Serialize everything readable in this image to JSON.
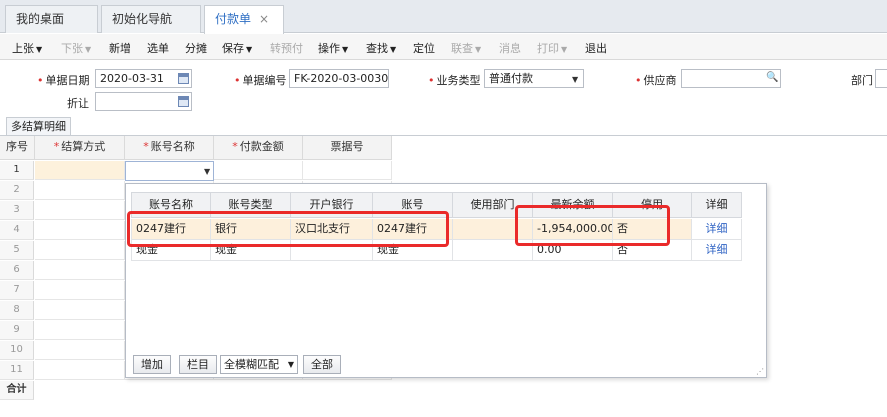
{
  "tabs": [
    {
      "label": "我的桌面"
    },
    {
      "label": "初始化导航"
    },
    {
      "label": "付款单",
      "close": "×"
    }
  ],
  "toolbar": {
    "items": [
      {
        "label": "上张",
        "caret": "▼",
        "disabled": false
      },
      {
        "label": "下张",
        "caret": "▼",
        "disabled": true
      },
      {
        "label": "新增"
      },
      {
        "label": "选单"
      },
      {
        "label": "分摊"
      },
      {
        "label": "保存",
        "caret": "▼"
      },
      {
        "label": "转预付",
        "disabled": true
      },
      {
        "label": "操作",
        "caret": "▼"
      },
      {
        "label": "查找",
        "caret": "▼"
      },
      {
        "label": "定位"
      },
      {
        "label": "联查",
        "caret": "▼",
        "disabled": true
      },
      {
        "label": "消息",
        "disabled": true
      },
      {
        "label": "打印",
        "caret": "▼",
        "disabled": true
      },
      {
        "label": "退出"
      }
    ]
  },
  "form": {
    "date_label": "单据日期",
    "date_value": "2020-03-31",
    "number_label": "单据编号",
    "number_value": "FK-2020-03-0030",
    "biztype_label": "业务类型",
    "biztype_value": "普通付款",
    "supplier_label": "供应商",
    "supplier_value": "",
    "dept_label": "部门",
    "discount_label": "折让",
    "discount_value": ""
  },
  "detail_tab": "多结算明细",
  "grid": {
    "headers": [
      "序号",
      "结算方式",
      "账号名称",
      "付款金额",
      "票据号"
    ],
    "row_numbers": [
      "1",
      "2",
      "3",
      "4",
      "5",
      "6",
      "7",
      "8",
      "9",
      "10",
      "11"
    ],
    "total_label": "合计"
  },
  "popup": {
    "headers": [
      "账号名称",
      "账号类型",
      "开户银行",
      "账号",
      "使用部门",
      "最新余额",
      "停用",
      "详细"
    ],
    "rows": [
      [
        "0247建行",
        "银行",
        "汉口北支行",
        "0247建行",
        "",
        "-1,954,000.00",
        "否",
        "详细"
      ],
      [
        "现金",
        "现金",
        "",
        "现金",
        "",
        "0.00",
        "否",
        "详细"
      ]
    ],
    "buttons": {
      "add": "增加",
      "columns": "栏目",
      "match_mode": "全模糊匹配",
      "all": "全部"
    }
  }
}
